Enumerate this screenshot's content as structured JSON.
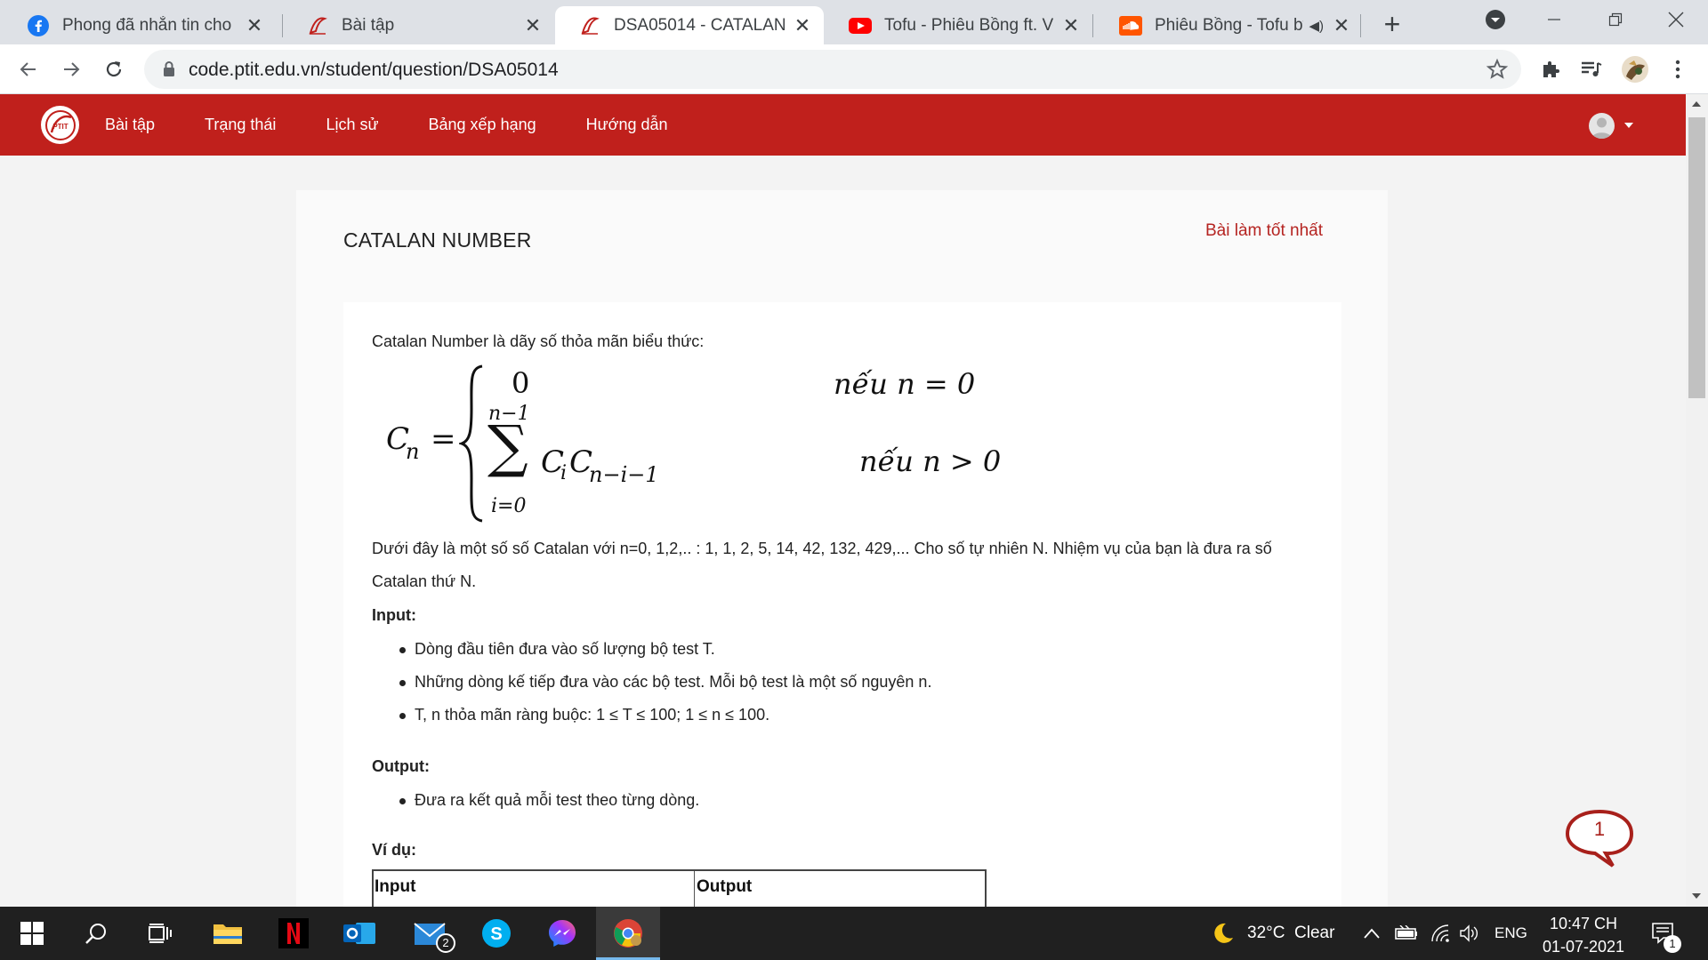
{
  "browser": {
    "tabs": [
      {
        "title": "Phong đã nhắn tin cho bạn",
        "icon": "facebook-icon",
        "active": false
      },
      {
        "title": "Bài tập",
        "icon": "ptit-icon",
        "active": false
      },
      {
        "title": "DSA05014 - CATALAN NUMBER",
        "icon": "ptit-icon",
        "active": true
      },
      {
        "title": "Tofu - Phiêu Bồng ft. VoVan",
        "icon": "youtube-icon",
        "active": false
      },
      {
        "title": "Phiêu Bồng - Tofu by",
        "icon": "soundcloud-icon",
        "active": false
      }
    ],
    "new_tab_label": "+",
    "url": "code.ptit.edu.vn/student/question/DSA05014"
  },
  "site": {
    "nav": [
      "Bài tập",
      "Trạng thái",
      "Lịch sử",
      "Bảng xếp hạng",
      "Hướng dẫn"
    ]
  },
  "question": {
    "title": "CATALAN NUMBER",
    "best_link": "Bài làm tốt nhất",
    "intro": "Catalan Number là dãy số thỏa mãn biểu thức:",
    "formula": {
      "lhs": "C",
      "lhs_sub": "n",
      "eq": "=",
      "case1_value": "0",
      "case1_cond": "nếu  n = 0",
      "sum_upper": "n−1",
      "sum_lower": "i=0",
      "sum_sign": "∑",
      "term_c1": "C",
      "term_c1_sub": "i",
      "term_c2": "C",
      "term_c2_sub": "n−i−1",
      "case2_cond": "nếu n > 0"
    },
    "desc_line1": "Dưới đây là một số số Catalan với n=0, 1,2,.. : 1, 1, 2, 5, 14, 42, 132, 429,... Cho số tự nhiên N. Nhiệm vụ của bạn là đưa ra số",
    "desc_line2": "Catalan thứ N.",
    "input_heading": "Input:",
    "input_items": [
      "Dòng đầu tiên đưa vào số lượng bộ test T.",
      "Những dòng kế tiếp đưa vào các bộ test. Mỗi bộ test là một số nguyên n.",
      "T, n thỏa mãn ràng buộc: 1 ≤ T ≤ 100;  1 ≤ n ≤ 100."
    ],
    "output_heading": "Output:",
    "output_items": [
      "Đưa ra kết quả mỗi test theo từng dòng."
    ],
    "example_heading": "Ví dụ:",
    "example_table_headers": [
      "Input",
      "Output"
    ]
  },
  "chat_badge": "1",
  "taskbar": {
    "mail_badge": "2",
    "weather": "32°C  Clear",
    "language": "ENG",
    "time": "10:47 CH",
    "date": "01-07-2021",
    "notification_count": "1"
  },
  "colors": {
    "brand_red": "#c0201c",
    "link_red": "#b52421",
    "tab_strip": "#dee1e6",
    "taskbar": "#202020"
  }
}
